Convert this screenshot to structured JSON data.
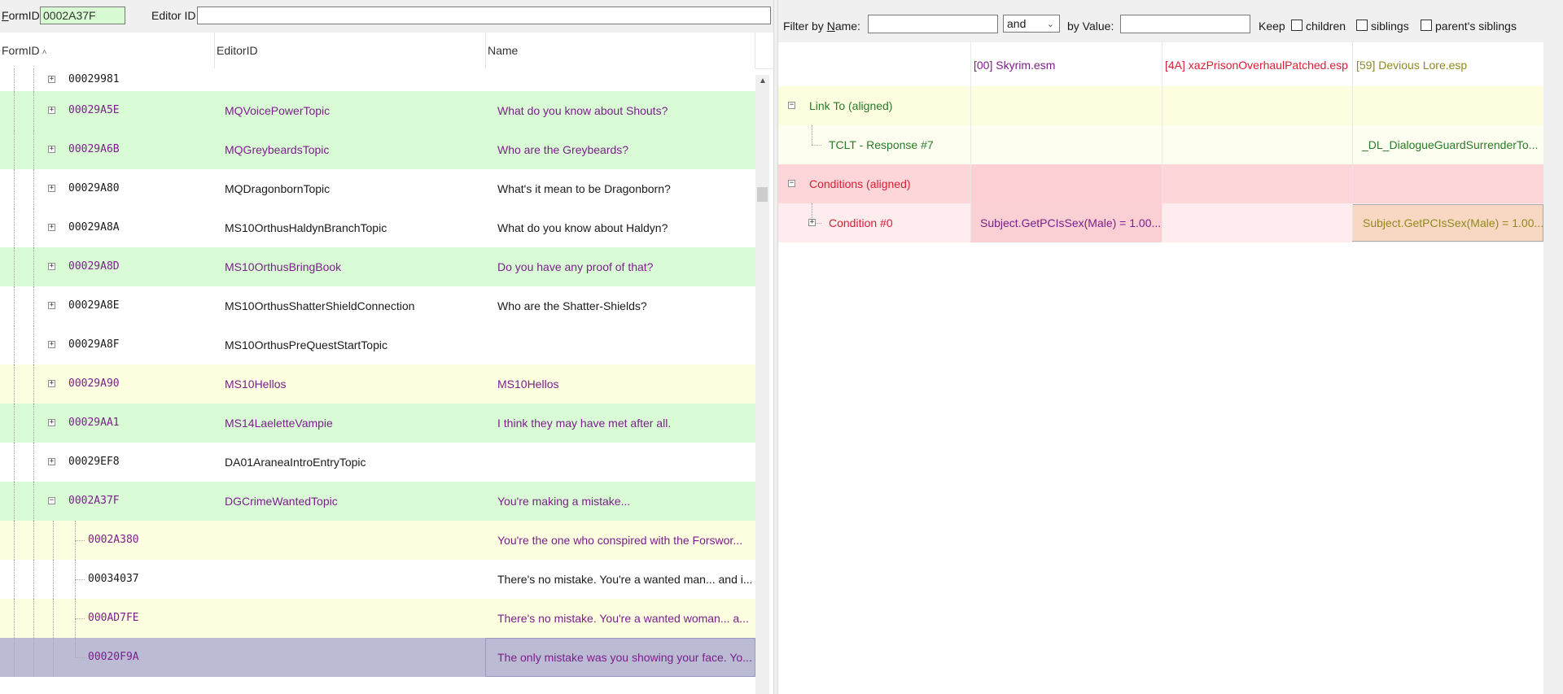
{
  "toolbar": {
    "formid_label": "FormID",
    "formid_value": "0002A37F",
    "editorid_label": "Editor ID",
    "editorid_value": ""
  },
  "list": {
    "columns": [
      "FormID",
      "EditorID",
      "Name"
    ],
    "sort_indicator": "˄",
    "rows": [
      {
        "formid": "00029981",
        "editorid": "",
        "name": "",
        "style": "white",
        "level": 1,
        "expander": "+"
      },
      {
        "formid": "00029A5E",
        "editorid": "MQVoicePowerTopic",
        "name": "What do you know about Shouts?",
        "style": "green",
        "level": 1,
        "expander": "+"
      },
      {
        "formid": "00029A6B",
        "editorid": "MQGreybeardsTopic",
        "name": "Who are the Greybeards?",
        "style": "green",
        "level": 1,
        "expander": "+"
      },
      {
        "formid": "00029A80",
        "editorid": "MQDragonbornTopic",
        "name": "What's it mean to be Dragonborn?",
        "style": "white",
        "level": 1,
        "expander": "+"
      },
      {
        "formid": "00029A8A",
        "editorid": "MS10OrthusHaldynBranchTopic",
        "name": "What do you know about Haldyn?",
        "style": "white",
        "level": 1,
        "expander": "+"
      },
      {
        "formid": "00029A8D",
        "editorid": "MS10OrthusBringBook",
        "name": "Do you have any proof of that?",
        "style": "green",
        "level": 1,
        "expander": "+"
      },
      {
        "formid": "00029A8E",
        "editorid": "MS10OrthusShatterShieldConnection",
        "name": "Who are the Shatter-Shields?",
        "style": "white",
        "level": 1,
        "expander": "+"
      },
      {
        "formid": "00029A8F",
        "editorid": "MS10OrthusPreQuestStartTopic",
        "name": "",
        "style": "white",
        "level": 1,
        "expander": "+"
      },
      {
        "formid": "00029A90",
        "editorid": "MS10Hellos",
        "name": "MS10Hellos",
        "style": "yellow",
        "level": 1,
        "expander": "+"
      },
      {
        "formid": "00029AA1",
        "editorid": "MS14LaeletteVampie",
        "name": "I think they may have met after all.",
        "style": "green",
        "level": 1,
        "expander": "+"
      },
      {
        "formid": "00029EF8",
        "editorid": "DA01AraneaIntroEntryTopic",
        "name": "",
        "style": "white",
        "level": 1,
        "expander": "+"
      },
      {
        "formid": "0002A37F",
        "editorid": "DGCrimeWantedTopic",
        "name": "You're making a mistake...",
        "style": "green",
        "level": 1,
        "expander": "−"
      },
      {
        "formid": "0002A380",
        "editorid": "",
        "name": "You're the one who conspired with the Forswor...",
        "style": "yellow",
        "level": 2,
        "expander": ""
      },
      {
        "formid": "00034037",
        "editorid": "",
        "name": "There's no mistake. You're a wanted man... and i...",
        "style": "white",
        "level": 2,
        "expander": ""
      },
      {
        "formid": "000AD7FE",
        "editorid": "",
        "name": "There's no mistake. You're a wanted woman... a...",
        "style": "yellow",
        "level": 2,
        "expander": ""
      },
      {
        "formid": "00020F9A",
        "editorid": "",
        "name": "The only mistake was you showing your face. Yo...",
        "style": "sel",
        "level": 2,
        "expander": ""
      }
    ]
  },
  "filter": {
    "by_name_label": "Filter by Name:",
    "name_value": "",
    "operator": "and",
    "by_value_label": "by Value:",
    "value_value": "",
    "keep_label": "Keep",
    "children_label": "children",
    "siblings_label": "siblings",
    "parents_siblings_label": "parent's siblings"
  },
  "compare": {
    "plugins": [
      {
        "label": "[00] Skyrim.esm",
        "color": "#7b1f8a"
      },
      {
        "label": "[4A] xazPrisonOverhaulPatched.esp",
        "color": "#d91e36"
      },
      {
        "label": "[59] Devious Lore.esp",
        "color": "#8f8a1f"
      }
    ],
    "rows": [
      {
        "name": "Link To (aligned)",
        "expander": "−",
        "indent": 0,
        "color": "green",
        "values": [
          "",
          "",
          ""
        ]
      },
      {
        "name": "TCLT - Response #7",
        "expander": "",
        "indent": 1,
        "color": "green",
        "values": [
          "",
          "",
          "_DL_DialogueGuardSurrenderTo..."
        ]
      },
      {
        "name": "Conditions (aligned)",
        "expander": "−",
        "indent": 0,
        "color": "red",
        "values": [
          "",
          "",
          ""
        ]
      },
      {
        "name": "Condition #0",
        "expander": "+",
        "indent": 1,
        "color": "red",
        "values": [
          "Subject.GetPCIsSex(Male) = 1.00...",
          "",
          "Subject.GetPCIsSex(Male) = 1.00..."
        ]
      }
    ]
  }
}
